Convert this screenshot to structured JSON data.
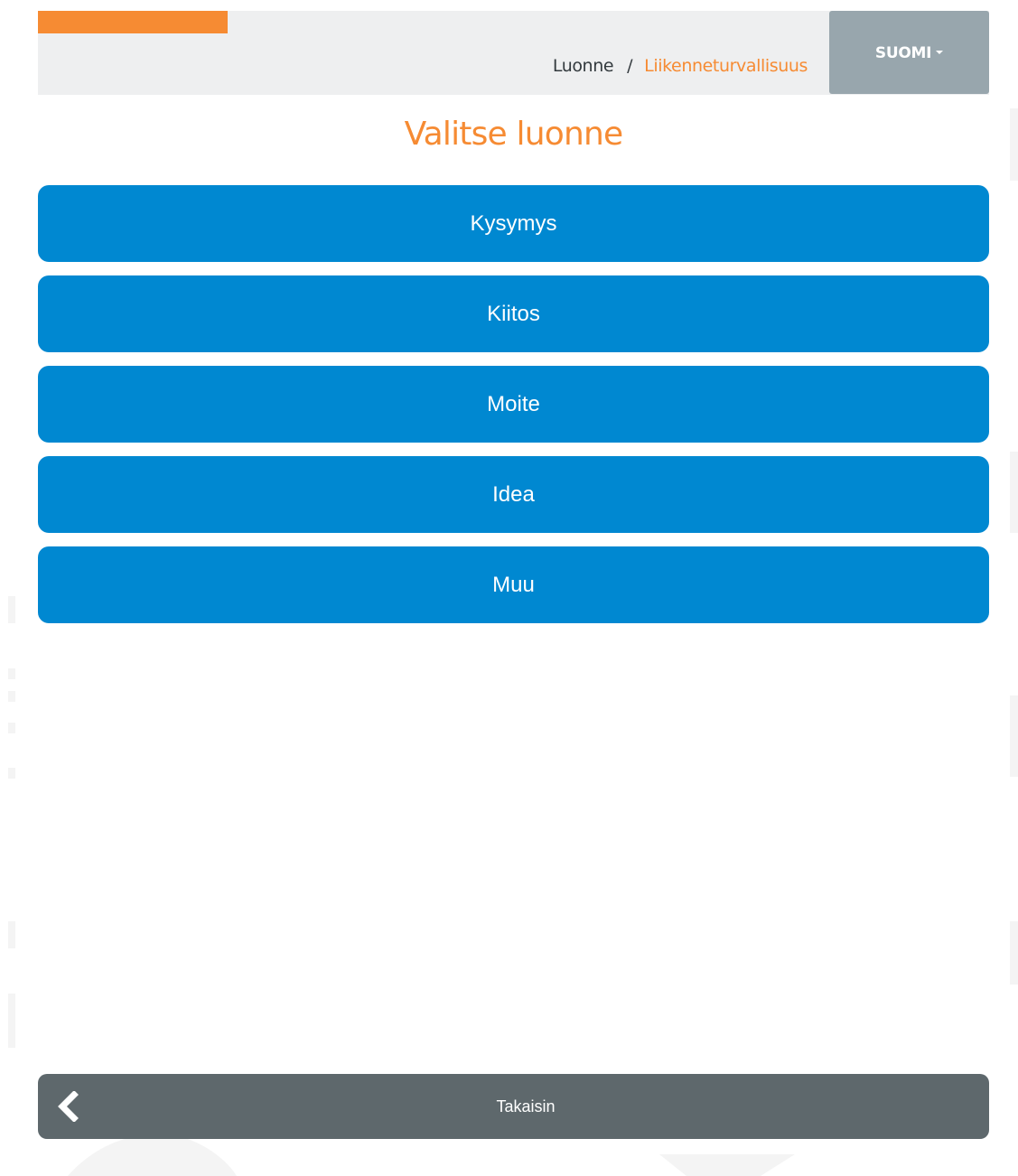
{
  "header": {
    "progress_percent": 24,
    "breadcrumb": {
      "parent": "Luonne",
      "separator": "/",
      "current": "Liikenneturvallisuus"
    },
    "language_label": "SUOMI"
  },
  "page_title": "Valitse luonne",
  "options": [
    {
      "label": "Kysymys"
    },
    {
      "label": "Kiitos"
    },
    {
      "label": "Moite"
    },
    {
      "label": "Idea"
    },
    {
      "label": "Muu"
    }
  ],
  "footer": {
    "back_label": "Takaisin",
    "back_icon": "chevron-left-icon"
  },
  "colors": {
    "accent_orange": "#f68b33",
    "option_blue": "#0088d1",
    "language_button_gray": "#98a6ad",
    "back_bar_gray": "#5e686c",
    "header_background": "#eeeff0"
  }
}
